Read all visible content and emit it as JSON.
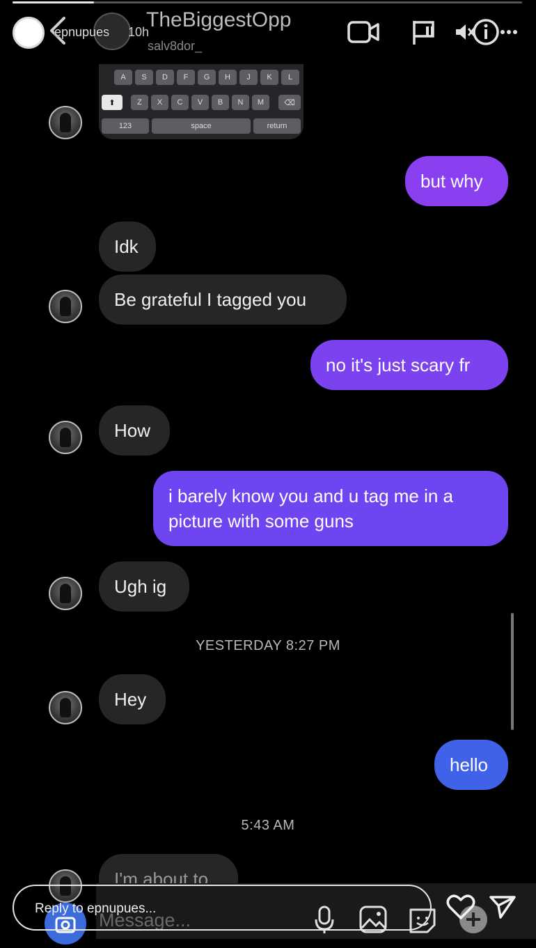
{
  "story": {
    "username": "epnupues",
    "time_ago": "10h",
    "progress": 0.16
  },
  "dm_header": {
    "name": "TheBiggestOpp",
    "handle": "salv8dor_"
  },
  "keyboard": {
    "row2": [
      "A",
      "S",
      "D",
      "F",
      "G",
      "H",
      "J",
      "K",
      "L"
    ],
    "row3": [
      "Z",
      "X",
      "C",
      "V",
      "B",
      "N",
      "M"
    ],
    "numbers_key": "123",
    "space_key": "space",
    "return_key": "return"
  },
  "thread": {
    "m1": "but why",
    "m2": "Idk",
    "m3": "Be grateful I tagged you",
    "m4": "no it's just scary fr",
    "m5": "How",
    "m6": "i barely know you and u tag me in a picture with some guns",
    "m7": "Ugh ig",
    "stamp1": "YESTERDAY 8:27 PM",
    "m8": "Hey",
    "m9": "hello",
    "stamp2": "5:43 AM",
    "m10": "I'm about to"
  },
  "footer": {
    "reply_placeholder": "Reply to epnupues...",
    "message_placeholder": "Message..."
  },
  "colors": {
    "outgoing_purple": "#8a3ff0",
    "outgoing_violet": "#6e45f0",
    "outgoing_blue": "#3f62e8",
    "incoming": "#262626"
  },
  "icons": [
    "back-chevron-icon",
    "video-call-icon",
    "flag-icon",
    "mute-icon",
    "info-icon",
    "more-icon",
    "microphone-icon",
    "image-icon",
    "sticker-icon",
    "heart-icon",
    "send-icon",
    "camera-icon",
    "plus-icon"
  ]
}
